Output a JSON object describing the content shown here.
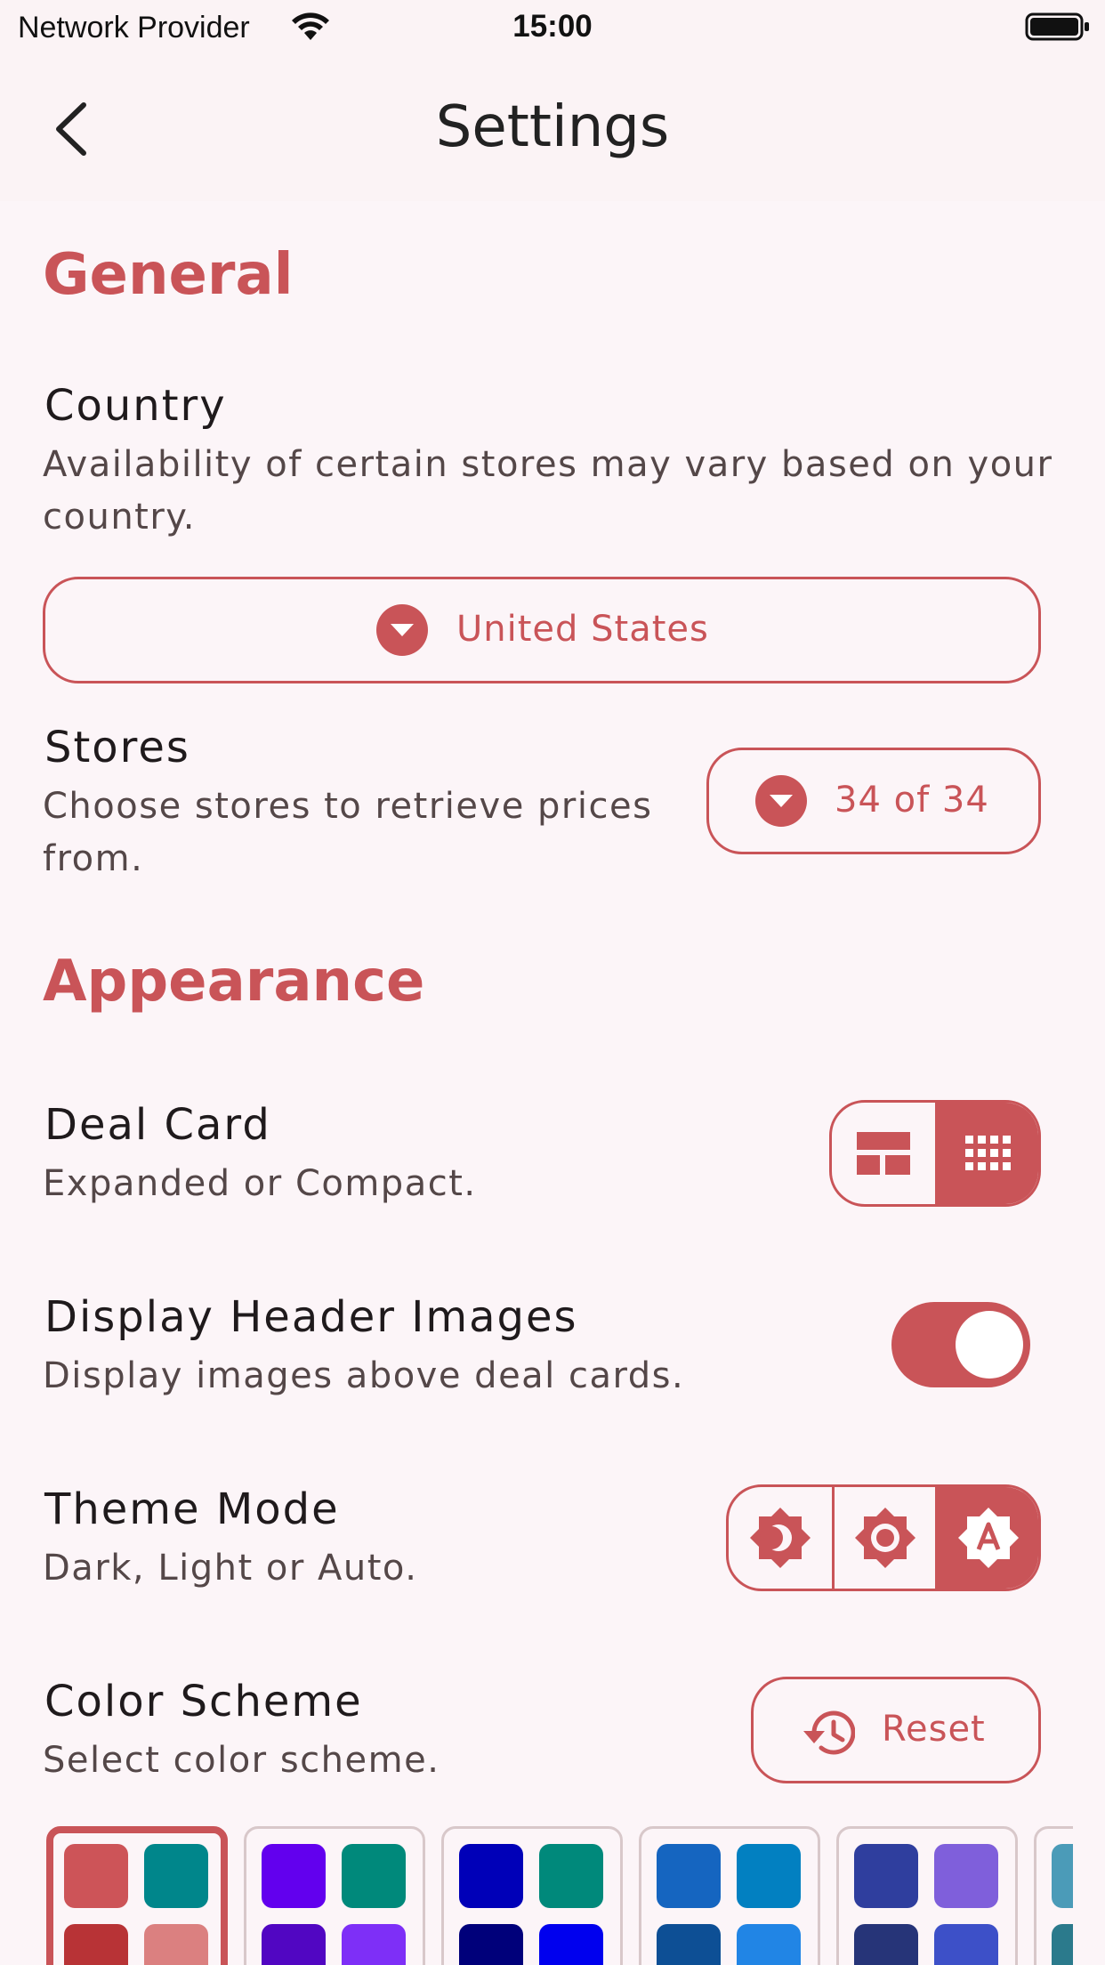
{
  "status_bar": {
    "carrier": "Network Provider",
    "time": "15:00"
  },
  "app_bar": {
    "title": "Settings"
  },
  "general": {
    "section_title": "General",
    "country": {
      "title": "Country",
      "subtitle_line1": "Availability of certain stores may vary based on your",
      "subtitle_line2": "country.",
      "value": "United States"
    },
    "stores": {
      "title": "Stores",
      "subtitle_line1": "Choose stores to retrieve prices",
      "subtitle_line2": "from.",
      "value": "34 of 34"
    }
  },
  "appearance": {
    "section_title": "Appearance",
    "deal_card": {
      "title": "Deal Card",
      "subtitle": "Expanded or Compact.",
      "selected": "compact"
    },
    "header_images": {
      "title": "Display Header Images",
      "subtitle": "Display images above deal cards.",
      "enabled": true
    },
    "theme_mode": {
      "title": "Theme Mode",
      "subtitle": "Dark, Light or Auto.",
      "selected": "auto"
    },
    "color_scheme": {
      "title": "Color Scheme",
      "subtitle": "Select color scheme.",
      "reset_label": "Reset",
      "schemes": [
        {
          "colors": [
            "#cd5458",
            "#00868b",
            "#b83336",
            "#db8080"
          ],
          "selected": true
        },
        {
          "colors": [
            "#6200ee",
            "#00897b",
            "#5106c2",
            "#7e2ff7"
          ],
          "selected": false
        },
        {
          "colors": [
            "#0000b8",
            "#00897b",
            "#00007a",
            "#0000ee"
          ],
          "selected": false
        },
        {
          "colors": [
            "#1565c0",
            "#0280c1",
            "#0d4f95",
            "#2185e5"
          ],
          "selected": false
        },
        {
          "colors": [
            "#2f3e9e",
            "#7f5fdb",
            "#263478",
            "#3d50c8"
          ],
          "selected": false
        },
        {
          "colors": [
            "#4b9bb8",
            "#4b9bb8",
            "#2b7a8c",
            "#2b7a8c"
          ],
          "selected": false
        }
      ]
    }
  },
  "colors": {
    "accent": "#c95458",
    "background": "#fcf5f8"
  }
}
